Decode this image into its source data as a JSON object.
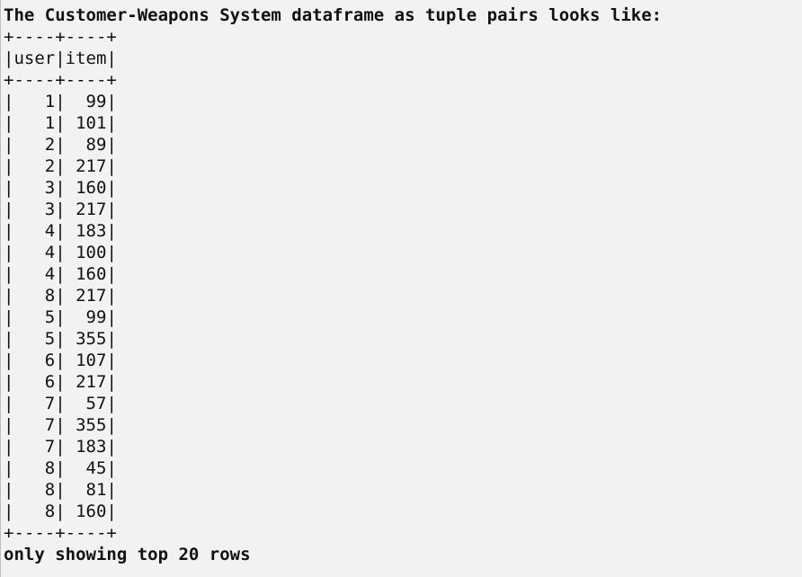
{
  "console": {
    "title_line": "The Customer-Weapons System dataframe as tuple pairs looks like:",
    "table_border": "+----+----+",
    "columns": [
      "user",
      "item"
    ],
    "rows": [
      {
        "user": "1",
        "item": "99"
      },
      {
        "user": "1",
        "item": "101"
      },
      {
        "user": "2",
        "item": "89"
      },
      {
        "user": "2",
        "item": "217"
      },
      {
        "user": "3",
        "item": "160"
      },
      {
        "user": "3",
        "item": "217"
      },
      {
        "user": "4",
        "item": "183"
      },
      {
        "user": "4",
        "item": "100"
      },
      {
        "user": "4",
        "item": "160"
      },
      {
        "user": "8",
        "item": "217"
      },
      {
        "user": "5",
        "item": "99"
      },
      {
        "user": "5",
        "item": "355"
      },
      {
        "user": "6",
        "item": "107"
      },
      {
        "user": "6",
        "item": "217"
      },
      {
        "user": "7",
        "item": "57"
      },
      {
        "user": "7",
        "item": "355"
      },
      {
        "user": "7",
        "item": "183"
      },
      {
        "user": "8",
        "item": "45"
      },
      {
        "user": "8",
        "item": "81"
      },
      {
        "user": "8",
        "item": "160"
      }
    ],
    "footer_line": "only showing top 20 rows"
  }
}
